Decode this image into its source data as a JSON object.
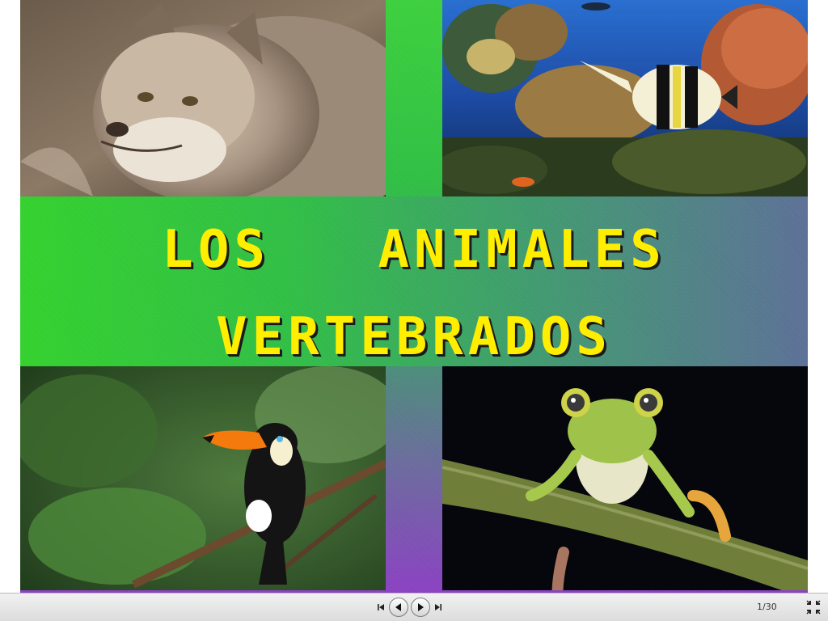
{
  "slide": {
    "title_line_1": "LOS   ANIMALES",
    "title_line_2": "VERTEBRADOS",
    "title_color": "#ffee00",
    "photos": [
      {
        "name": "lynx-photo",
        "subject": "lince"
      },
      {
        "name": "fish-photo",
        "subject": "pez"
      },
      {
        "name": "toucan-photo",
        "subject": "tucán"
      },
      {
        "name": "frog-photo",
        "subject": "rana"
      }
    ]
  },
  "player": {
    "slide_counter": "1/30",
    "icons": {
      "first": "skip-to-first-icon",
      "prev": "previous-slide-icon",
      "next": "next-slide-icon",
      "last": "skip-to-last-icon",
      "fullscreen": "exit-fullscreen-icon"
    }
  }
}
